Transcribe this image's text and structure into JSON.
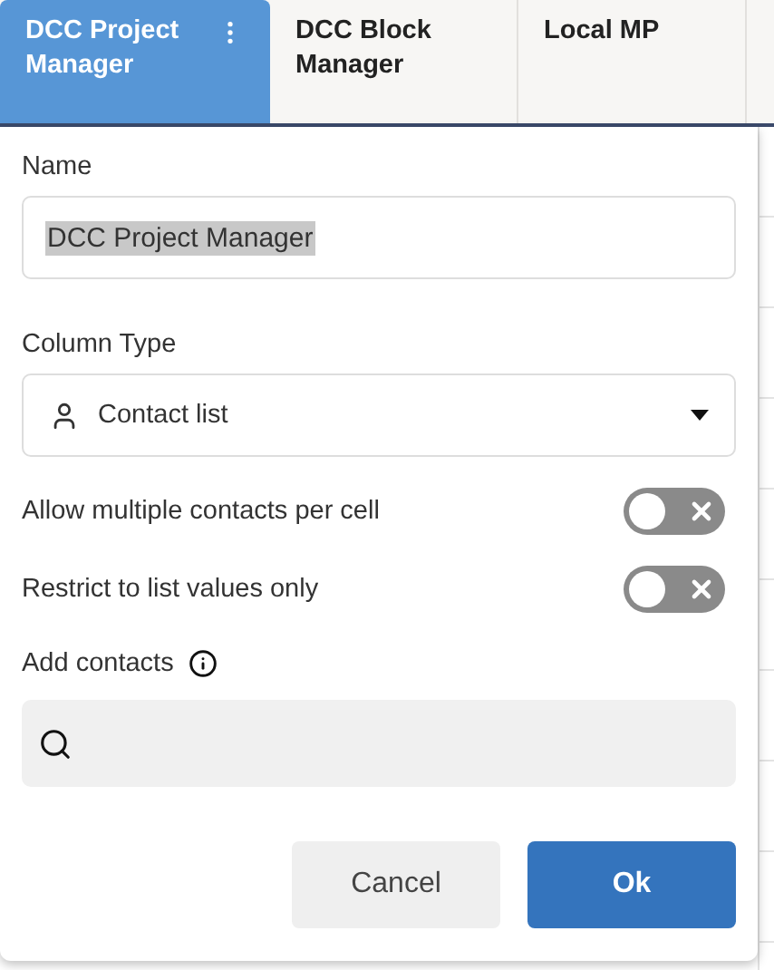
{
  "tabs": [
    {
      "label": "DCC Project Manager",
      "selected": true
    },
    {
      "label": "DCC Block Manager",
      "selected": false
    },
    {
      "label": "Local MP",
      "selected": false
    }
  ],
  "dialog": {
    "name_label": "Name",
    "name_value": "DCC Project Manager",
    "name_highlighted": true,
    "column_type_label": "Column Type",
    "column_type_value": "Contact list",
    "toggles": [
      {
        "label": "Allow multiple contacts per cell",
        "on": false
      },
      {
        "label": "Restrict to list values only",
        "on": false
      }
    ],
    "add_contacts_label": "Add contacts",
    "buttons": [
      {
        "label": "Cancel",
        "kind": "secondary"
      },
      {
        "label": "Ok",
        "kind": "primary"
      }
    ]
  }
}
